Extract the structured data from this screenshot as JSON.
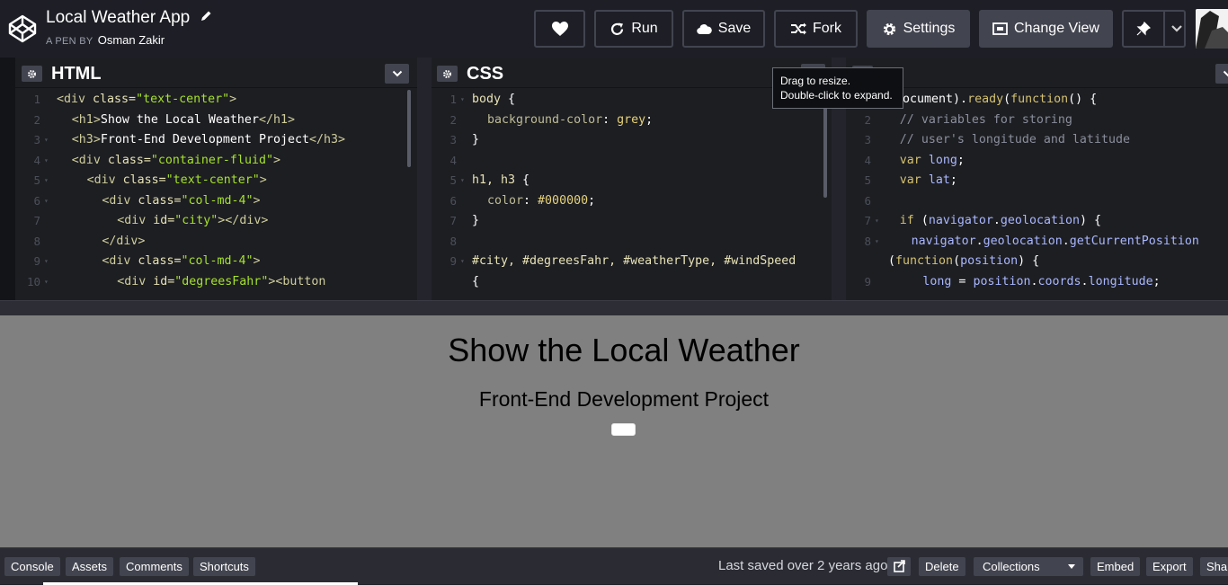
{
  "header": {
    "title": "Local Weather App",
    "by_prefix": "A PEN BY",
    "author": "Osman Zakir",
    "buttons": {
      "run": "Run",
      "save": "Save",
      "fork": "Fork",
      "settings": "Settings",
      "change_view": "Change View"
    }
  },
  "editors": {
    "html": {
      "title": "HTML",
      "lines": [
        {
          "n": "1",
          "fold": "",
          "indent": 0,
          "segments": [
            [
              "tag",
              "<div "
            ],
            [
              "attr",
              "class="
            ],
            [
              "str",
              "\"text-center\""
            ],
            [
              "tag",
              ">"
            ]
          ]
        },
        {
          "n": "2",
          "fold": "",
          "indent": 1,
          "segments": [
            [
              "tag",
              "<h1>"
            ],
            [
              "plain",
              "Show the Local Weather"
            ],
            [
              "tag",
              "</h1>"
            ]
          ]
        },
        {
          "n": "3",
          "fold": "▾",
          "indent": 1,
          "segments": [
            [
              "tag",
              "<h3>"
            ],
            [
              "plain",
              "Front-End Development Project"
            ],
            [
              "tag",
              "</h3>"
            ]
          ]
        },
        {
          "n": "4",
          "fold": "▾",
          "indent": 1,
          "segments": [
            [
              "tag",
              "<div "
            ],
            [
              "attr",
              "class="
            ],
            [
              "str",
              "\"container-fluid\""
            ],
            [
              "tag",
              ">"
            ]
          ]
        },
        {
          "n": "5",
          "fold": "▾",
          "indent": 2,
          "segments": [
            [
              "tag",
              "<div "
            ],
            [
              "attr",
              "class="
            ],
            [
              "str",
              "\"text-center\""
            ],
            [
              "tag",
              ">"
            ]
          ]
        },
        {
          "n": "6",
          "fold": "▾",
          "indent": 3,
          "segments": [
            [
              "tag",
              "<div "
            ],
            [
              "attr",
              "class="
            ],
            [
              "str",
              "\"col-md-4\""
            ],
            [
              "tag",
              ">"
            ]
          ]
        },
        {
          "n": "7",
          "fold": "",
          "indent": 4,
          "segments": [
            [
              "tag",
              "<div "
            ],
            [
              "attr",
              "id="
            ],
            [
              "str",
              "\"city\""
            ],
            [
              "tag",
              "></div>"
            ]
          ]
        },
        {
          "n": "8",
          "fold": "",
          "indent": 3,
          "segments": [
            [
              "tag",
              "</div>"
            ]
          ]
        },
        {
          "n": "9",
          "fold": "▾",
          "indent": 3,
          "segments": [
            [
              "tag",
              "<div "
            ],
            [
              "attr",
              "class="
            ],
            [
              "str",
              "\"col-md-4\""
            ],
            [
              "tag",
              ">"
            ]
          ]
        },
        {
          "n": "10",
          "fold": "▾",
          "indent": 4,
          "segments": [
            [
              "tag",
              "<div "
            ],
            [
              "attr",
              "id="
            ],
            [
              "str",
              "\"degreesFahr\""
            ],
            [
              "tag",
              "><button"
            ]
          ]
        }
      ]
    },
    "css": {
      "title": "CSS",
      "lines": [
        {
          "n": "1",
          "fold": "▾",
          "indent": 0,
          "segments": [
            [
              "sel",
              "body "
            ],
            [
              "plain",
              "{"
            ]
          ]
        },
        {
          "n": "2",
          "fold": "",
          "indent": 1,
          "segments": [
            [
              "prop",
              "background-color"
            ],
            [
              "plain",
              ": "
            ],
            [
              "val",
              "grey"
            ],
            [
              "plain",
              ";"
            ]
          ]
        },
        {
          "n": "3",
          "fold": "",
          "indent": 0,
          "segments": [
            [
              "plain",
              "}"
            ]
          ]
        },
        {
          "n": "4",
          "fold": "",
          "indent": 0,
          "segments": []
        },
        {
          "n": "5",
          "fold": "▾",
          "indent": 0,
          "segments": [
            [
              "sel",
              "h1, h3 "
            ],
            [
              "plain",
              "{"
            ]
          ]
        },
        {
          "n": "6",
          "fold": "",
          "indent": 1,
          "segments": [
            [
              "prop",
              "color"
            ],
            [
              "plain",
              ": "
            ],
            [
              "val",
              "#000000"
            ],
            [
              "plain",
              ";"
            ]
          ]
        },
        {
          "n": "7",
          "fold": "",
          "indent": 0,
          "segments": [
            [
              "plain",
              "}"
            ]
          ]
        },
        {
          "n": "8",
          "fold": "",
          "indent": 0,
          "segments": []
        },
        {
          "n": "9",
          "fold": "▾",
          "indent": 0,
          "segments": [
            [
              "sel",
              "#city, #degreesFahr, #weatherType, #windSpeed"
            ]
          ]
        },
        {
          "n": "",
          "fold": "",
          "indent": 0,
          "segments": [
            [
              "plain",
              "{"
            ]
          ]
        }
      ]
    },
    "js": {
      "lines": [
        {
          "n": "",
          "fold": "",
          "indent": 0,
          "segments": [
            [
              "plain",
              "(document)."
            ],
            [
              "kw",
              "ready"
            ],
            [
              "plain",
              "("
            ],
            [
              "kw",
              "function"
            ],
            [
              "plain",
              "() {"
            ]
          ]
        },
        {
          "n": "2",
          "fold": "",
          "indent": 1,
          "segments": [
            [
              "cmt",
              "// variables for storing"
            ]
          ]
        },
        {
          "n": "3",
          "fold": "",
          "indent": 1,
          "segments": [
            [
              "cmt",
              "// user's longitude and latitude"
            ]
          ]
        },
        {
          "n": "4",
          "fold": "",
          "indent": 1,
          "segments": [
            [
              "kw",
              "var "
            ],
            [
              "var",
              "long"
            ],
            [
              "plain",
              ";"
            ]
          ]
        },
        {
          "n": "5",
          "fold": "",
          "indent": 1,
          "segments": [
            [
              "kw",
              "var "
            ],
            [
              "var",
              "lat"
            ],
            [
              "plain",
              ";"
            ]
          ]
        },
        {
          "n": "6",
          "fold": "",
          "indent": 0,
          "segments": []
        },
        {
          "n": "7",
          "fold": "▾",
          "indent": 1,
          "segments": [
            [
              "kw",
              "if "
            ],
            [
              "plain",
              "("
            ],
            [
              "var",
              "navigator"
            ],
            [
              "plain",
              "."
            ],
            [
              "var",
              "geolocation"
            ],
            [
              "plain",
              ") {"
            ]
          ]
        },
        {
          "n": "8",
          "fold": "▾",
          "indent": 2,
          "segments": [
            [
              "var",
              "navigator"
            ],
            [
              "plain",
              "."
            ],
            [
              "var",
              "geolocation"
            ],
            [
              "plain",
              "."
            ],
            [
              "var",
              "getCurrentPosition"
            ]
          ]
        },
        {
          "n": "",
          "fold": "",
          "indent": 0,
          "segments": [
            [
              "plain",
              "("
            ],
            [
              "kw",
              "function"
            ],
            [
              "plain",
              "("
            ],
            [
              "var",
              "position"
            ],
            [
              "plain",
              ") {"
            ]
          ]
        },
        {
          "n": "9",
          "fold": "",
          "indent": 3,
          "segments": [
            [
              "var",
              "long "
            ],
            [
              "plain",
              "= "
            ],
            [
              "var",
              "position"
            ],
            [
              "plain",
              "."
            ],
            [
              "var",
              "coords"
            ],
            [
              "plain",
              "."
            ],
            [
              "var",
              "longitude"
            ],
            [
              "plain",
              ";"
            ]
          ]
        }
      ]
    }
  },
  "tooltip": {
    "line1": "Drag to resize.",
    "line2": "Double-click to expand."
  },
  "preview": {
    "h1": "Show the Local Weather",
    "h3": "Front-End Development Project"
  },
  "footer": {
    "console": "Console",
    "assets": "Assets",
    "comments": "Comments",
    "shortcuts": "Shortcuts",
    "last_saved": "Last saved over 2 years ago",
    "delete": "Delete",
    "collections": "Collections",
    "embed": "Embed",
    "export": "Export",
    "share": "Shar"
  },
  "colors": {
    "header_bg": "#1e1f26",
    "editor_bg": "#1d1e22",
    "preview_bg": "#808080",
    "button_bg": "#42444f"
  }
}
